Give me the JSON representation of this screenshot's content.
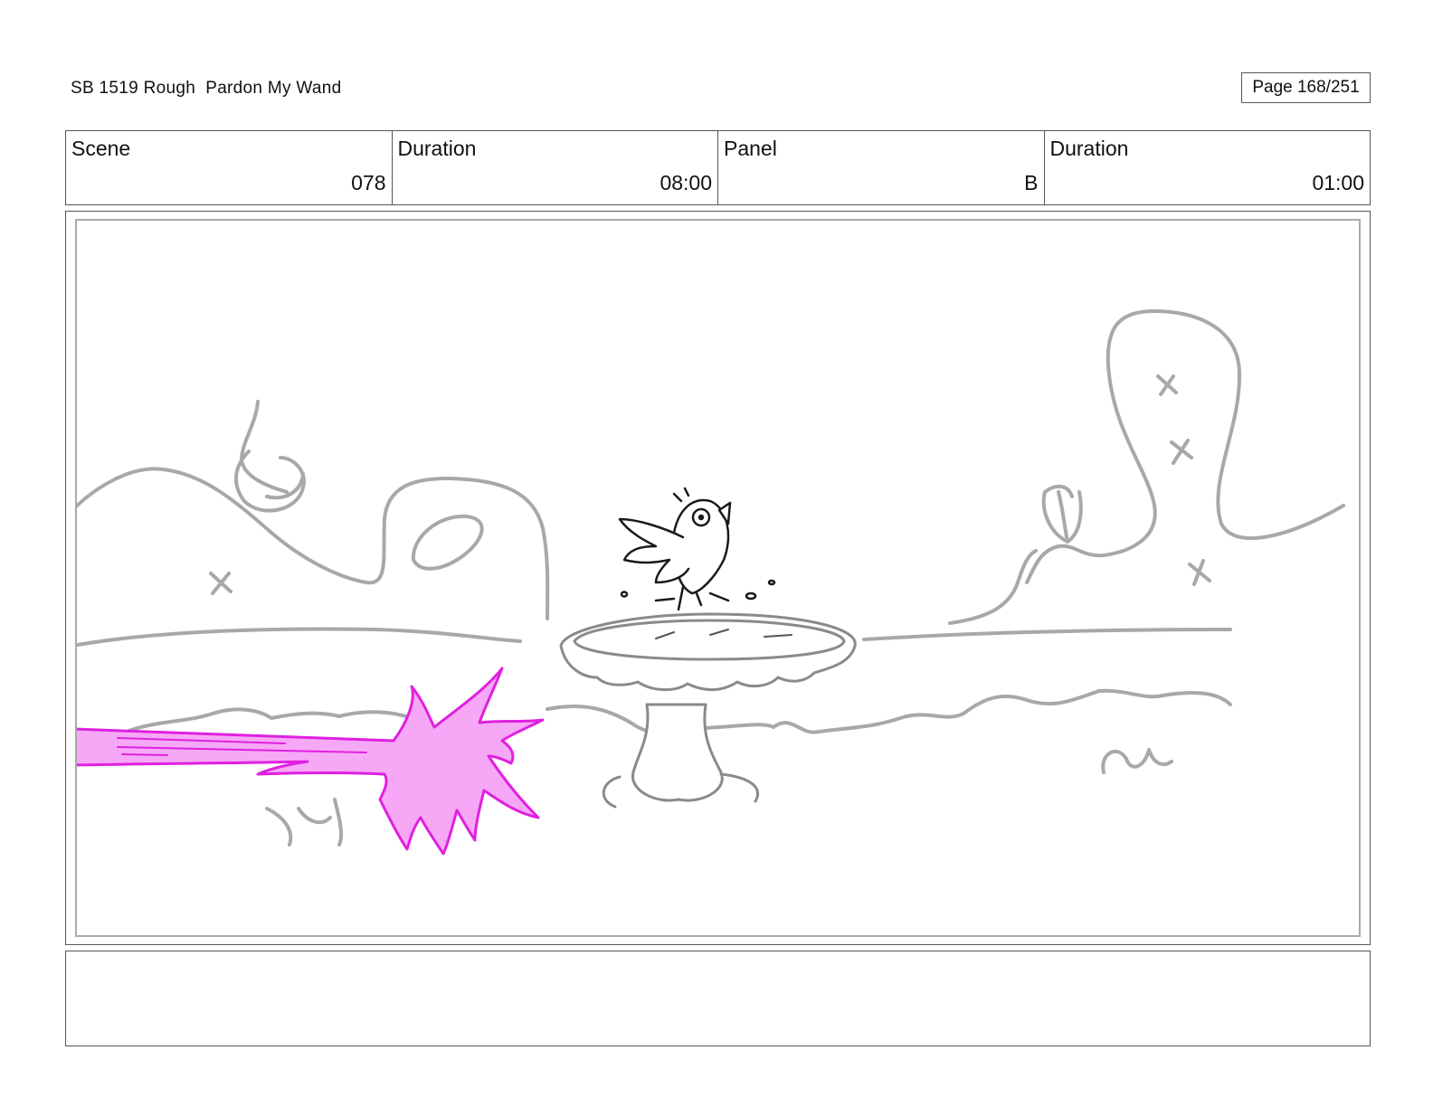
{
  "header": {
    "title": "SB 1519 Rough  Pardon My Wand",
    "page": "Page 168/251"
  },
  "info": {
    "scene_label": "Scene",
    "scene_value": "078",
    "duration_label": "Duration",
    "duration_value": "08:00",
    "panel_label": "Panel",
    "panel_value": "B",
    "panel_duration_label": "Duration",
    "panel_duration_value": "01:00"
  },
  "notes": {
    "text": ""
  },
  "colors": {
    "sketch_gray": "#9e9e9e",
    "ink_black": "#1a1a1a",
    "magic_magenta": "#e020e0",
    "magic_fill": "#f6a8f6"
  }
}
